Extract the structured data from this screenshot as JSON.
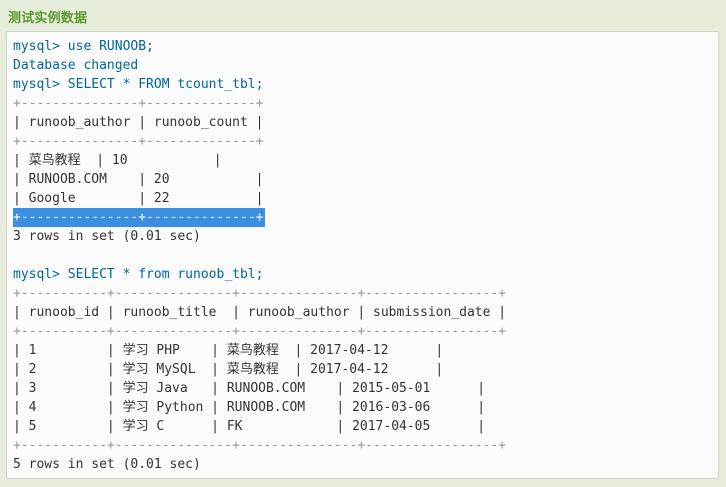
{
  "heading": "测试实例数据",
  "lines": {
    "l1": "mysql> use RUNOOB;",
    "l2": "Database changed",
    "l3": "mysql> SELECT * FROM tcount_tbl;",
    "t1_top": "+---------------+--------------+",
    "t1_head": "| runoob_author | runoob_count |",
    "t1_sep": "+---------------+--------------+",
    "t1_r1": "| 菜鸟教程  | 10           |",
    "t1_r2": "| RUNOOB.COM    | 20           |",
    "t1_r3": "| Google        | 22           |",
    "t1_bottom": "+---------------+--------------+",
    "res1": "3 rows in set (0.01 sec)",
    "blank": "",
    "q2": "mysql> SELECT * from runoob_tbl;",
    "t2_top": "+-----------+---------------+---------------+-----------------+",
    "t2_head": "| runoob_id | runoob_title  | runoob_author | submission_date |",
    "t2_sep": "+-----------+---------------+---------------+-----------------+",
    "t2_r1": "| 1         | 学习 PHP    | 菜鸟教程  | 2017-04-12      |",
    "t2_r2": "| 2         | 学习 MySQL  | 菜鸟教程  | 2017-04-12      |",
    "t2_r3": "| 3         | 学习 Java   | RUNOOB.COM    | 2015-05-01      |",
    "t2_r4": "| 4         | 学习 Python | RUNOOB.COM    | 2016-03-06      |",
    "t2_r5": "| 5         | 学习 C      | FK            | 2017-04-05      |",
    "t2_bottom": "+-----------+---------------+---------------+-----------------+",
    "res2": "5 rows in set (0.01 sec)"
  },
  "colors": {
    "heading": "#5b9a32",
    "keyword": "#006699",
    "number": "#8b1a1a",
    "selection": "#3b8fe3"
  }
}
